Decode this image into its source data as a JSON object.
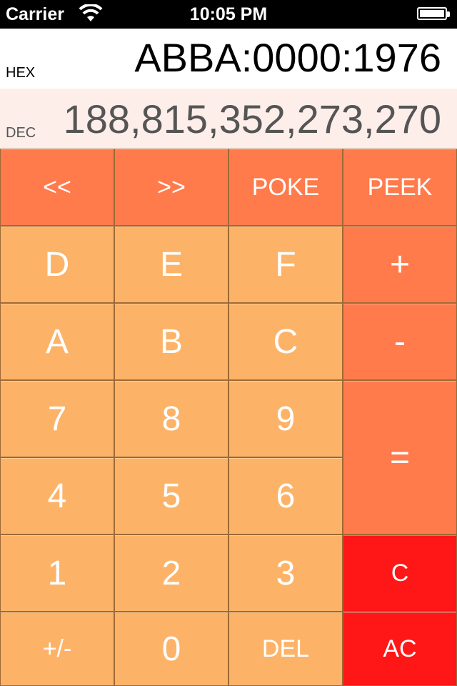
{
  "status_bar": {
    "carrier": "Carrier",
    "time": "10:05 PM"
  },
  "display": {
    "hex_label": "HEX",
    "hex_value": "ABBA:0000:1976",
    "dec_label": "DEC",
    "dec_value": "188,815,352,273,270"
  },
  "keys": {
    "shift_left": "<<",
    "shift_right": ">>",
    "poke": "POKE",
    "peek": "PEEK",
    "d": "D",
    "e": "E",
    "f": "F",
    "plus": "+",
    "a": "A",
    "b": "B",
    "c_hex": "C",
    "minus": "-",
    "seven": "7",
    "eight": "8",
    "nine": "9",
    "equals": "=",
    "four": "4",
    "five": "5",
    "six": "6",
    "one": "1",
    "two": "2",
    "three": "3",
    "clear": "C",
    "sign": "+/-",
    "zero": "0",
    "del": "DEL",
    "all_clear": "AC"
  },
  "colors": {
    "digit_key": "#fdb367",
    "operator_key": "#ff7b4c",
    "clear_key": "#ff1717"
  }
}
